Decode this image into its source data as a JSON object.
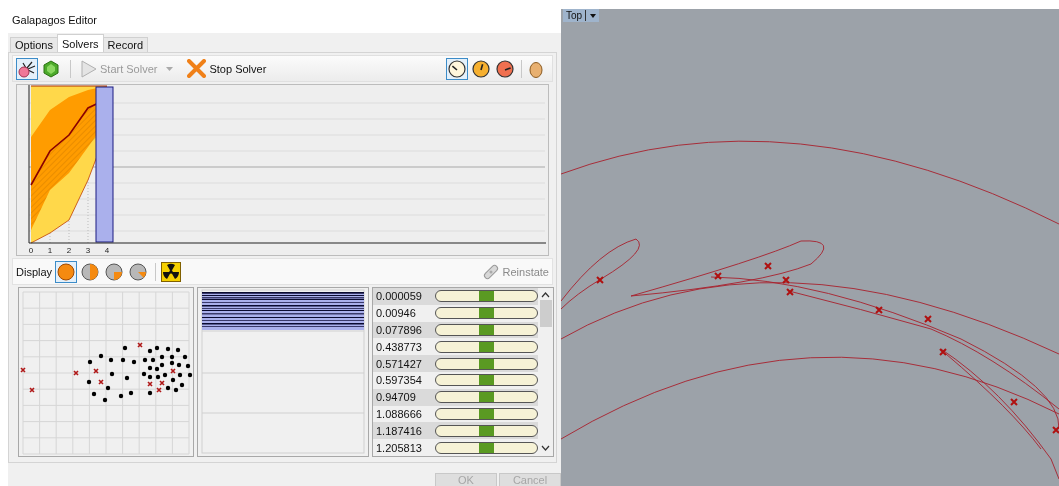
{
  "window": {
    "title": "Galapagos Editor"
  },
  "tabs": [
    {
      "label": "Options",
      "selected": false
    },
    {
      "label": "Solvers",
      "selected": true
    },
    {
      "label": "Record",
      "selected": false
    }
  ],
  "toolbar": {
    "solver_types": [
      {
        "kind": "evolutionary",
        "selected": true
      },
      {
        "kind": "annealing",
        "selected": false
      }
    ],
    "start": {
      "label": "Start Solver",
      "disabled": true
    },
    "stop": {
      "label": "Stop Solver",
      "disabled": false
    },
    "speeds": [
      {
        "kind": "slow",
        "selected": true
      },
      {
        "kind": "medium",
        "selected": false
      },
      {
        "kind": "fast",
        "selected": false
      }
    ]
  },
  "chart": {
    "x_ticks": [
      "0",
      "1",
      "2",
      "3",
      "4"
    ]
  },
  "display": {
    "label": "Display",
    "modes": [
      {
        "kind": "full",
        "selected": true
      },
      {
        "kind": "half",
        "selected": false
      },
      {
        "kind": "quarter",
        "selected": false
      },
      {
        "kind": "eighth",
        "selected": false
      }
    ],
    "reinstate": {
      "label": "Reinstate",
      "disabled": true
    }
  },
  "genomes": [
    {
      "value": "0.000059",
      "level": 0.5
    },
    {
      "value": "0.00946",
      "level": 0.5
    },
    {
      "value": "0.077896",
      "level": 0.5
    },
    {
      "value": "0.438773",
      "level": 0.5
    },
    {
      "value": "0.571427",
      "level": 0.5
    },
    {
      "value": "0.597354",
      "level": 0.5
    },
    {
      "value": "0.94709",
      "level": 0.5
    },
    {
      "value": "1.088666",
      "level": 0.5
    },
    {
      "value": "1.187416",
      "level": 0.5
    },
    {
      "value": "1.205813",
      "level": 0.5
    }
  ],
  "buttons": [
    {
      "label": "OK",
      "disabled": true
    },
    {
      "label": "Cancel",
      "disabled": true
    }
  ],
  "viewport": {
    "label": "Top"
  }
}
